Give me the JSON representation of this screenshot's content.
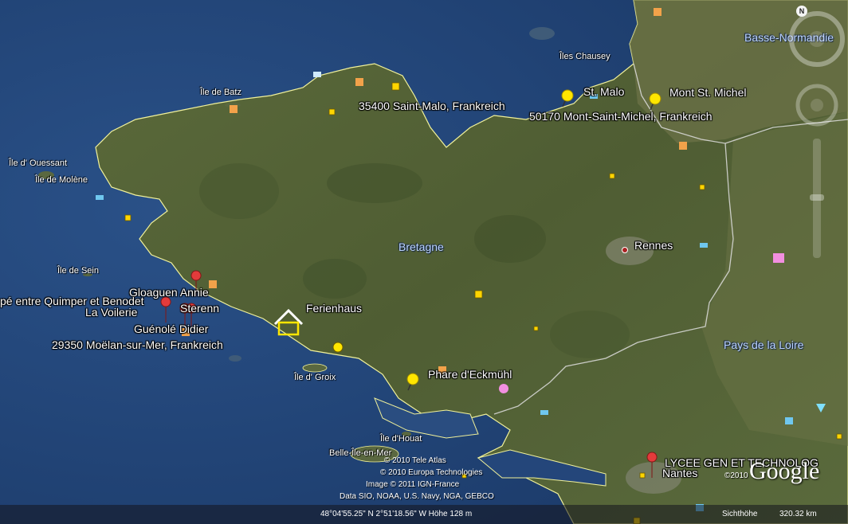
{
  "places": {
    "saint_malo_addr": "35400 Saint-Malo, Frankreich",
    "st_malo": "St. Malo",
    "mont_st_michel": "Mont St. Michel",
    "mont_addr": "50170 Mont-Saint-Michel, Frankreich",
    "rennes": "Rennes",
    "bretagne": "Bretagne",
    "ferienhaus": "Ferienhaus",
    "phare": "Phare d'Eckmühl",
    "nantes": "Nantes",
    "lycee": "LYCEE GEN ET TECHNOLOG",
    "gloaguen": "Gloaguen Annie",
    "quimper": "pé entre Quimper et Benodet",
    "sterenn": "Sterenn",
    "voilerie": "La Voilerie",
    "guenole": "Guénolé Didier",
    "moelan_addr": "29350 Moëlan-sur-Mer, Frankreich"
  },
  "islands": {
    "batz": "Île de Batz",
    "ouessant": "Île d' Ouessant",
    "molene": "Île de Molène",
    "sein": "Île de Sein",
    "groix": "Île d' Groix",
    "houat": "Île d'Houat",
    "belle_ile": "Belle-Île-en-Mer",
    "chausey": "Îles Chausey"
  },
  "regions": {
    "basse_normandie": "Basse-Normandie",
    "pays_de_la_loire": "Pays de la Loire"
  },
  "copyright": {
    "tele_atlas": "© 2010 Tele Atlas",
    "europa": "© 2010 Europa Technologies",
    "ign": "Image © 2011 IGN-France",
    "data": "Data SIO, NOAA, U.S. Navy, NGA, GEBCO",
    "year": "©2010"
  },
  "status": {
    "coords": "48°04'55.25\" N    2°51'18.56\" W  Höhe  128 m",
    "eye_label": "Sichthöhe",
    "eye_value": "320.32 km"
  },
  "logo": "Google",
  "nav": {
    "north": "N"
  },
  "colors": {
    "land": "#4e5e34",
    "sea": "#24467a",
    "border": "#e8e8a0",
    "pin": "#ffe600"
  }
}
